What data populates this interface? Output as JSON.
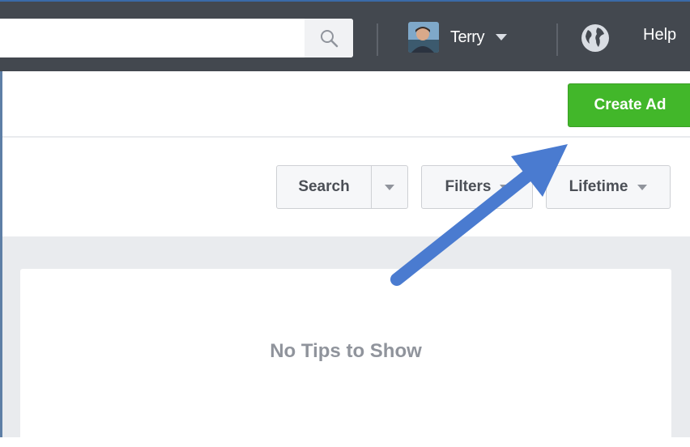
{
  "topbar": {
    "search": {
      "value": "",
      "placeholder": ""
    },
    "user": {
      "name": "Terry"
    },
    "help_label": "Help"
  },
  "header": {
    "create_ad_label": "Create Ad"
  },
  "controls": {
    "search_label": "Search",
    "filters_label": "Filters",
    "lifetime_label": "Lifetime"
  },
  "tips": {
    "empty_text": "No Tips to Show"
  },
  "icons": {
    "search": "magnifier-icon",
    "user_caret": "caret-down-icon",
    "globe": "globe-icon",
    "arrow": "annotation-arrow"
  },
  "colors": {
    "topbar_bg": "#43484f",
    "create_ad_green": "#42b72a",
    "tips_bg": "#e9ebee",
    "annotation_arrow": "#4a7bd0"
  }
}
